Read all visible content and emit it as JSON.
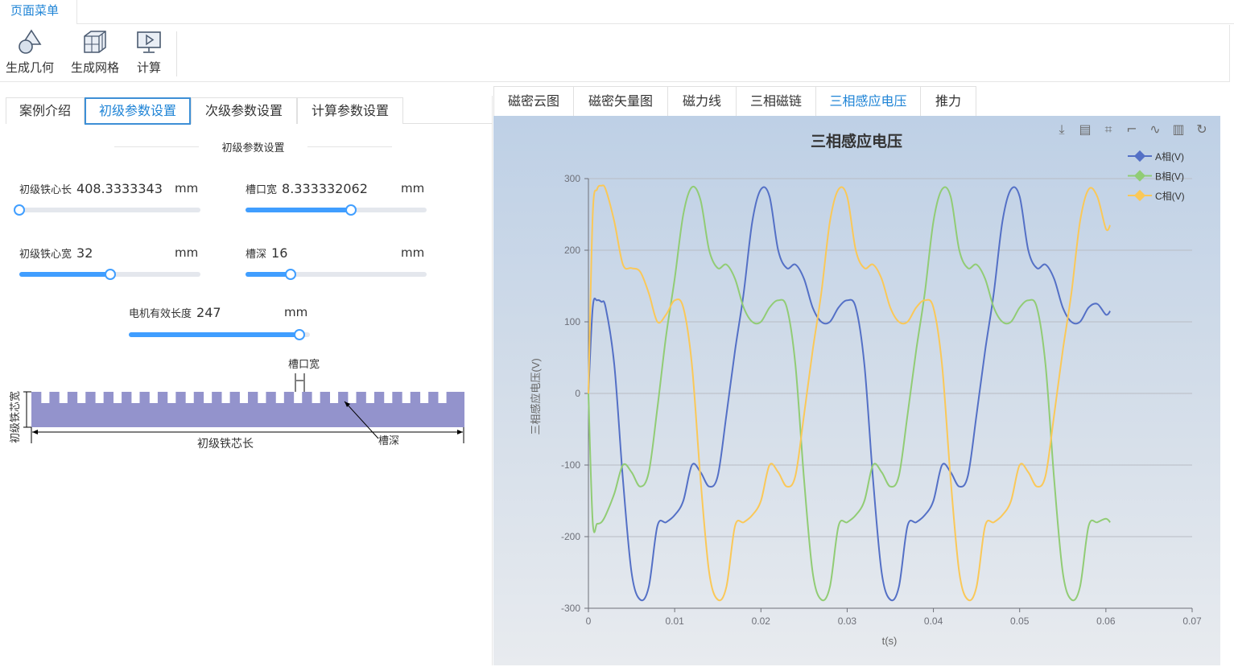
{
  "menu": {
    "tab_label": "页面菜单"
  },
  "toolbar": {
    "items": [
      {
        "label": "生成几何",
        "icon": "geometry-icon"
      },
      {
        "label": "生成网格",
        "icon": "mesh-icon"
      },
      {
        "label": "计算",
        "icon": "compute-icon"
      }
    ]
  },
  "left_tabs": [
    {
      "label": "案例介绍",
      "active": false
    },
    {
      "label": "初级参数设置",
      "active": true
    },
    {
      "label": "次级参数设置",
      "active": false
    },
    {
      "label": "计算参数设置",
      "active": false
    }
  ],
  "section_title": "初级参数设置",
  "params": {
    "core_length": {
      "label": "初级铁心长",
      "value": "408.3333343",
      "unit": "mm",
      "slider_fraction": 0.0
    },
    "slot_width": {
      "label": "槽口宽",
      "value": "8.333332062",
      "unit": "mm",
      "slider_fraction": 0.58
    },
    "core_width": {
      "label": "初级铁心宽",
      "value": "32",
      "unit": "mm",
      "slider_fraction": 0.5
    },
    "slot_depth": {
      "label": "槽深",
      "value": "16",
      "unit": "mm",
      "slider_fraction": 0.25
    },
    "motor_length": {
      "label": "电机有效长度",
      "value": "247",
      "unit": "mm",
      "slider_fraction": 0.94
    }
  },
  "diagram": {
    "slot_width_label": "槽口宽",
    "core_width_label": "初级铁芯宽",
    "core_length_label": "初级铁芯长",
    "slot_depth_label": "槽深",
    "core_color": "#9393cc"
  },
  "right_tabs": [
    {
      "label": "磁密云图",
      "active": false
    },
    {
      "label": "磁密矢量图",
      "active": false
    },
    {
      "label": "磁力线",
      "active": false
    },
    {
      "label": "三相磁链",
      "active": false
    },
    {
      "label": "三相感应电压",
      "active": true
    },
    {
      "label": "推力",
      "active": false
    }
  ],
  "chart_tools": [
    "download-icon",
    "data-view-icon",
    "zoom-icon",
    "zoom-reset-icon",
    "line-chart-icon",
    "bar-chart-icon",
    "refresh-icon"
  ],
  "chart_data": {
    "type": "line",
    "title": "三相感应电压",
    "xlabel": "t(s)",
    "ylabel": "三相感应电压(V)",
    "xlim": [
      0,
      0.07
    ],
    "ylim": [
      -300,
      300
    ],
    "xticks": [
      "0",
      "0.01",
      "0.02",
      "0.03",
      "0.04",
      "0.05",
      "0.06",
      "0.07"
    ],
    "yticks": [
      "300",
      "200",
      "100",
      "0",
      "-100",
      "-200",
      "-300"
    ],
    "grid": true,
    "legend_position": "top-right",
    "x": [
      0,
      0.0005,
      0.001,
      0.0015,
      0.002,
      0.003,
      0.004,
      0.005,
      0.006,
      0.007,
      0.008,
      0.009,
      0.01,
      0.011,
      0.012,
      0.013,
      0.014,
      0.015,
      0.016,
      0.017,
      0.018,
      0.019,
      0.02,
      0.021,
      0.022,
      0.023,
      0.024,
      0.025,
      0.026,
      0.027,
      0.028,
      0.029,
      0.03,
      0.031,
      0.032,
      0.033,
      0.034,
      0.035,
      0.036,
      0.037,
      0.038,
      0.039,
      0.04,
      0.041,
      0.042,
      0.043,
      0.044,
      0.045,
      0.046,
      0.047,
      0.048,
      0.049,
      0.05,
      0.051,
      0.052,
      0.053,
      0.054,
      0.055,
      0.056,
      0.057,
      0.058,
      0.059,
      0.06,
      0.0605
    ],
    "series": [
      {
        "name": "A相(V)",
        "color": "#5470c6",
        "values": [
          0,
          120,
          130,
          128,
          120,
          40,
          -120,
          -250,
          -288,
          -270,
          -185,
          -180,
          -170,
          -150,
          -100,
          -110,
          -130,
          -115,
          -30,
          60,
          140,
          240,
          285,
          275,
          200,
          175,
          180,
          160,
          120,
          100,
          100,
          120,
          130,
          120,
          40,
          -120,
          -250,
          -288,
          -270,
          -185,
          -180,
          -170,
          -150,
          -100,
          -110,
          -130,
          -115,
          -30,
          60,
          140,
          240,
          285,
          275,
          200,
          175,
          180,
          160,
          120,
          100,
          100,
          120,
          125,
          110,
          115
        ]
      },
      {
        "name": "B相(V)",
        "color": "#91cc75",
        "values": [
          0,
          -180,
          -182,
          -180,
          -170,
          -140,
          -100,
          -110,
          -130,
          -110,
          -20,
          80,
          160,
          250,
          288,
          270,
          200,
          175,
          180,
          160,
          120,
          100,
          100,
          120,
          130,
          120,
          40,
          -120,
          -250,
          -288,
          -270,
          -185,
          -180,
          -170,
          -150,
          -100,
          -110,
          -130,
          -115,
          -30,
          60,
          140,
          240,
          285,
          275,
          200,
          175,
          180,
          160,
          120,
          100,
          100,
          120,
          130,
          120,
          40,
          -120,
          -250,
          -288,
          -270,
          -185,
          -180,
          -175,
          -180
        ]
      },
      {
        "name": "C相(V)",
        "color": "#fac858",
        "values": [
          0,
          250,
          285,
          290,
          285,
          240,
          180,
          175,
          170,
          140,
          100,
          110,
          130,
          120,
          40,
          -120,
          -250,
          -288,
          -270,
          -185,
          -180,
          -170,
          -150,
          -100,
          -110,
          -130,
          -115,
          -30,
          60,
          140,
          240,
          285,
          275,
          200,
          175,
          180,
          160,
          120,
          100,
          100,
          120,
          130,
          120,
          40,
          -120,
          -250,
          -288,
          -270,
          -185,
          -180,
          -170,
          -150,
          -100,
          -110,
          -130,
          -115,
          -30,
          60,
          140,
          240,
          285,
          275,
          230,
          235
        ]
      }
    ]
  }
}
